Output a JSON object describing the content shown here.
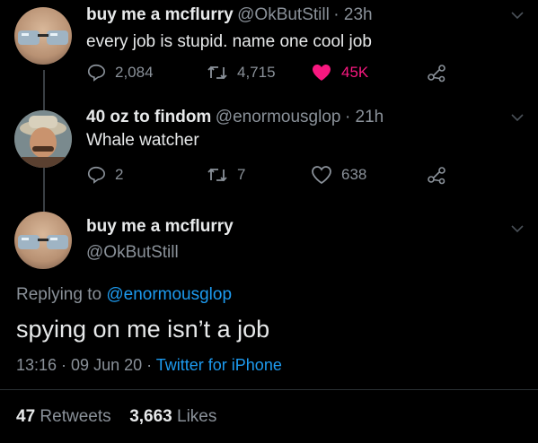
{
  "tweets": [
    {
      "display_name": "buy me a mcflurry",
      "handle": "@OkButStill",
      "time": "· 23h",
      "text": "every job is stupid. name one cool job",
      "replies": "2,084",
      "retweets": "4,715",
      "likes": "45K",
      "liked": true
    },
    {
      "display_name": "40 oz to findom",
      "handle": "@enormousglop",
      "time": "· 21h",
      "text": "Whale watcher",
      "replies": "2",
      "retweets": "7",
      "likes": "638",
      "liked": false
    }
  ],
  "main_tweet": {
    "display_name": "buy me a mcflurry",
    "handle": "@OkButStill",
    "replying_prefix": "Replying to ",
    "replying_to": "@enormousglop",
    "text": "spying on me isn’t a job",
    "timestamp": "13:16 · 09 Jun 20 · ",
    "source": "Twitter for iPhone",
    "retweet_count": "47",
    "retweet_label": "Retweets",
    "like_count": "3,663",
    "like_label": "Likes"
  },
  "colors": {
    "background": "#000000",
    "like_red": "#f91880",
    "link_blue": "#1d9bf0"
  },
  "icons": [
    "reply-icon",
    "retweet-icon",
    "heart-icon",
    "share-icon",
    "chevron-down-icon"
  ]
}
